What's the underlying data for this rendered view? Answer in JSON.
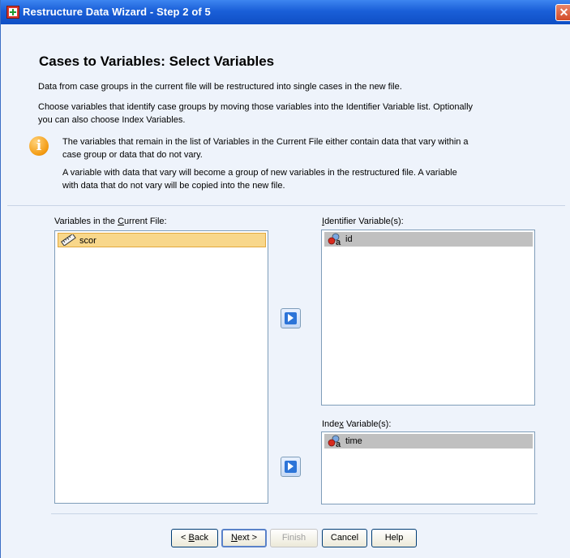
{
  "window": {
    "title": "Restructure Data Wizard - Step 2 of 5",
    "close_glyph": "✕"
  },
  "heading": "Cases to Variables: Select Variables",
  "paragraphs": {
    "p1": "Data from case groups in the current file will be restructured into single cases in the new file.",
    "p2_line1": "Choose variables that identify case groups by moving those variables into the Identifier Variable list.  Optionally",
    "p2_line2": "you can also choose Index Variables.",
    "info1_line1": "The variables that remain in the list of Variables in the Current File either contain data that vary within a",
    "info1_line2": "case group or data that do not vary.",
    "info2_line1": "A variable with data that vary will become a group of new variables in the restructured file.  A variable",
    "info2_line2": "with data that do not vary will be copied into the new file."
  },
  "current_file": {
    "label_pre": "Variables in the ",
    "label_ul": "C",
    "label_post": "urrent File:",
    "items": [
      "scor"
    ],
    "icon": "scale-ruler-icon"
  },
  "identifier": {
    "label_pre": "",
    "label_ul": "I",
    "label_post": "dentifier Variable(s):",
    "items": [
      "id"
    ],
    "icon": "nominal-variable-icon"
  },
  "index": {
    "label_pre": "Inde",
    "label_ul": "x",
    "label_post": " Variable(s):",
    "items": [
      "time"
    ],
    "icon": "nominal-variable-icon"
  },
  "buttons": {
    "back_prefix": "< ",
    "back_ul": "B",
    "back_rest": "ack",
    "next_ul": "N",
    "next_rest": "ext >",
    "finish": "Finish",
    "cancel": "Cancel",
    "help": "Help"
  },
  "colors": {
    "titlebar": "#1a5fd8",
    "selected_orange": "#f8d78b",
    "selected_gray": "#c0c0c0",
    "arrow_blue": "#2c74d8"
  }
}
